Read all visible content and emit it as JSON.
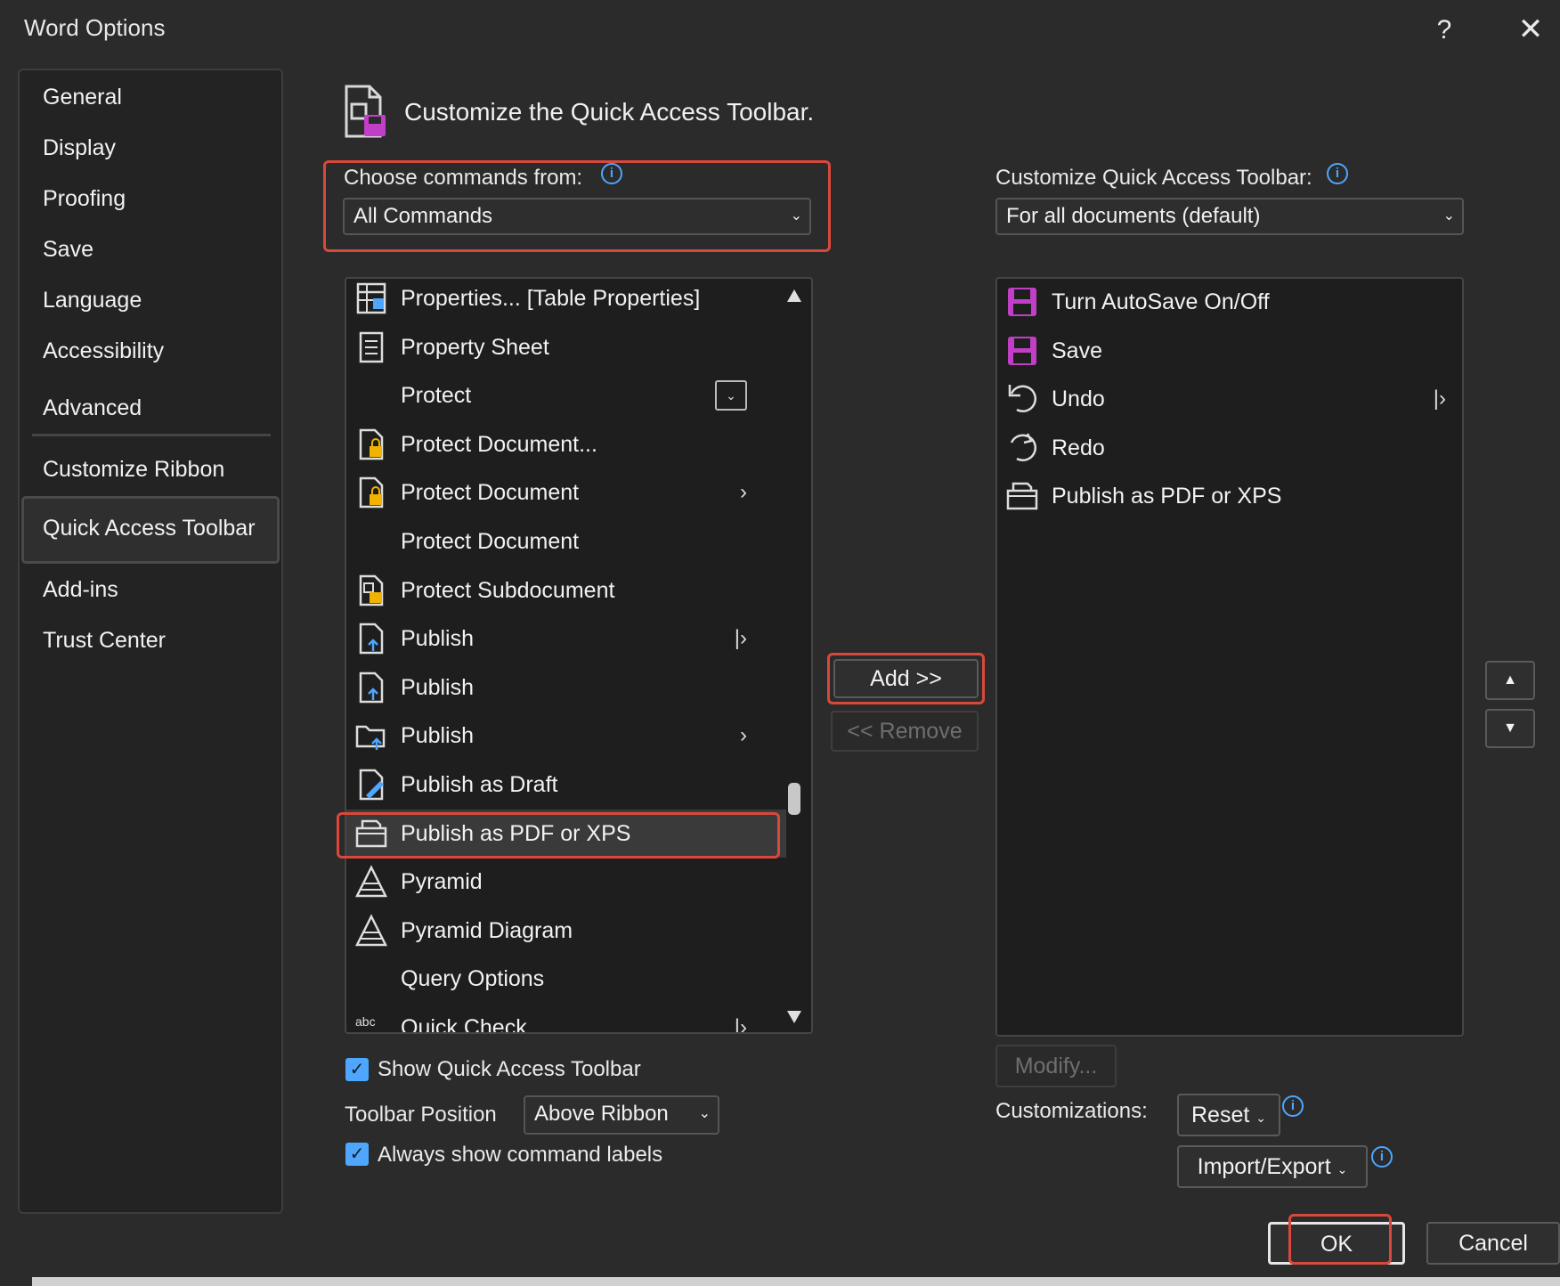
{
  "dialog": {
    "title": "Word Options",
    "help_glyph": "?",
    "close_glyph": "✕"
  },
  "sidebar": {
    "items": [
      {
        "label": "General"
      },
      {
        "label": "Display"
      },
      {
        "label": "Proofing"
      },
      {
        "label": "Save"
      },
      {
        "label": "Language"
      },
      {
        "label": "Accessibility"
      },
      {
        "label": "Advanced"
      },
      {
        "label": "Customize Ribbon"
      },
      {
        "label": "Quick Access Toolbar",
        "selected": true
      },
      {
        "label": "Add-ins"
      },
      {
        "label": "Trust Center"
      }
    ]
  },
  "header": {
    "text": "Customize the Quick Access Toolbar."
  },
  "choose_commands": {
    "label": "Choose commands from:",
    "value": "All Commands"
  },
  "customize_qat": {
    "label": "Customize Quick Access Toolbar:",
    "value": "For all documents (default)"
  },
  "commands_list": {
    "items": [
      {
        "label": "Properties... [Table Properties]",
        "icon": "table-properties-icon"
      },
      {
        "label": "Property Sheet",
        "icon": "property-sheet-icon"
      },
      {
        "label": "Protect",
        "icon": "none",
        "suffix": "dropdown-box"
      },
      {
        "label": "Protect Document...",
        "icon": "protect-document-icon"
      },
      {
        "label": "Protect Document",
        "icon": "protect-document-icon",
        "suffix": "arrow"
      },
      {
        "label": "Protect Document",
        "icon": "none"
      },
      {
        "label": "Protect Subdocument",
        "icon": "protect-subdocument-icon"
      },
      {
        "label": "Publish",
        "icon": "publish-icon",
        "suffix": "split-arrow"
      },
      {
        "label": "Publish",
        "icon": "publish-icon"
      },
      {
        "label": "Publish",
        "icon": "publish-folder-icon",
        "suffix": "arrow"
      },
      {
        "label": "Publish as Draft",
        "icon": "publish-draft-icon"
      },
      {
        "label": "Publish as PDF or XPS",
        "icon": "publish-pdf-icon",
        "selected": true
      },
      {
        "label": "Pyramid",
        "icon": "pyramid-icon"
      },
      {
        "label": "Pyramid Diagram",
        "icon": "pyramid-icon"
      },
      {
        "label": "Query Options",
        "icon": "none"
      },
      {
        "label": "Quick Check",
        "icon": "abc-icon",
        "suffix": "split-arrow"
      }
    ]
  },
  "toolbar_list": {
    "items": [
      {
        "label": "Turn AutoSave On/Off",
        "icon": "autosave-icon"
      },
      {
        "label": "Save",
        "icon": "save-icon"
      },
      {
        "label": "Undo",
        "icon": "undo-icon",
        "suffix": "split-arrow"
      },
      {
        "label": "Redo",
        "icon": "redo-icon"
      },
      {
        "label": "Publish as PDF or XPS",
        "icon": "publish-pdf-icon"
      }
    ]
  },
  "buttons": {
    "add": "Add >>",
    "remove": "<< Remove",
    "modify": "Modify...",
    "reset": "Reset",
    "import_export": "Import/Export",
    "ok": "OK",
    "cancel": "Cancel"
  },
  "options": {
    "show_qat_label": "Show Quick Access Toolbar",
    "show_qat_checked": true,
    "toolbar_position_label": "Toolbar Position",
    "toolbar_position_value": "Above Ribbon",
    "always_show_labels_label": "Always show command labels",
    "always_show_labels_checked": true,
    "customizations_label": "Customizations:"
  },
  "colors": {
    "accent_blue": "#4ea6ff",
    "highlight_red": "#d9483b",
    "save_icon_magenta": "#c13ec7",
    "background": "#2b2b2b"
  }
}
